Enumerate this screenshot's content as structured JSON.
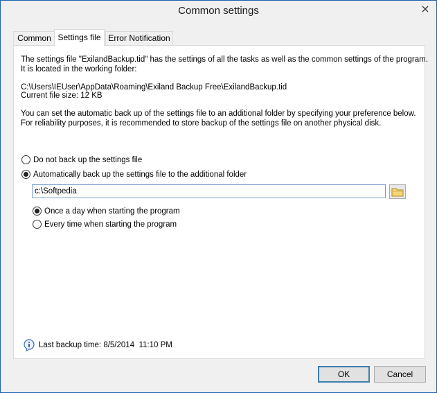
{
  "window": {
    "title": "Common settings"
  },
  "tabs": [
    {
      "label": "Common"
    },
    {
      "label": "Settings file"
    },
    {
      "label": "Error Notification"
    }
  ],
  "panel": {
    "intro_line1": "The settings file \"ExilandBackup.tid\" has the settings of all the tasks as well as the common settings of the program.",
    "intro_line2": "It is located in the working folder:",
    "path_line": "C:\\Users\\IEUser\\AppData\\Roaming\\Exiland Backup Free\\ExilandBackup.tid",
    "size_line": "Current file size: 12 KB",
    "auto_line1": "You can set the automatic back up of the settings file to an additional folder by specifying your preference below.",
    "auto_line2": "For reliability purposes, it is recommended to store backup of the settings file on another physical disk.",
    "radio_no_backup": "Do not back up the settings file",
    "radio_auto_backup": "Automatically back up the settings file to the additional folder",
    "backup_folder": "c:\\Softpedia",
    "radio_once_day": "Once a day when starting the program",
    "radio_every_time": "Every time when starting the program",
    "last_backup": "Last backup time: 8/5/2014  11:10 PM"
  },
  "buttons": {
    "ok": "OK",
    "cancel": "Cancel"
  },
  "state": {
    "backup_mode": "auto",
    "frequency": "once_a_day"
  },
  "icons": {
    "close": "close-icon",
    "folder": "folder-icon",
    "info": "info-icon"
  }
}
